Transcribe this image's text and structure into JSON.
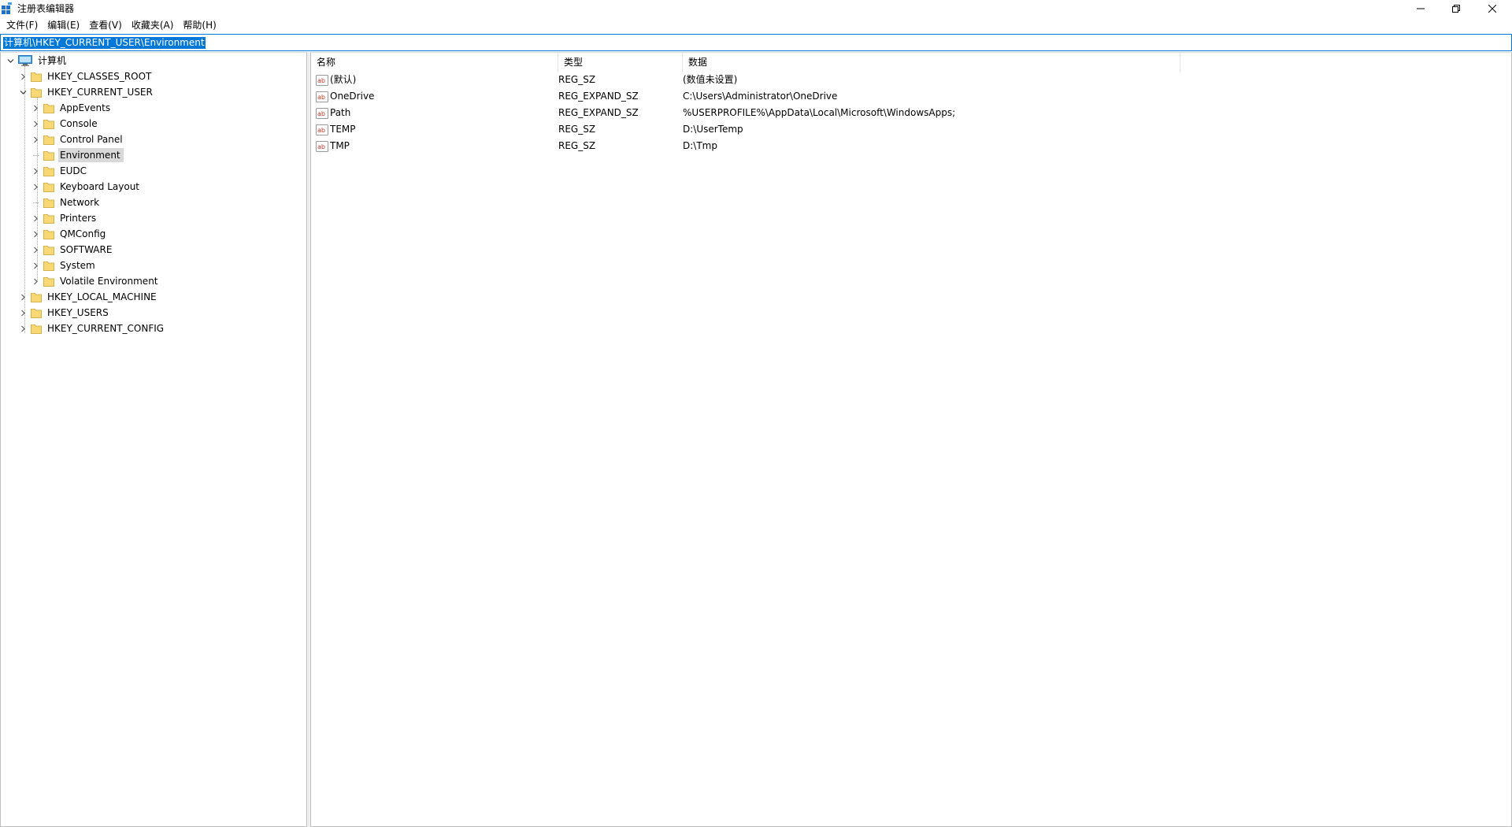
{
  "window": {
    "title": "注册表编辑器",
    "icon": "registry-editor-icon",
    "controls": [
      "minimize-icon",
      "restore-icon",
      "close-icon"
    ]
  },
  "menu": [
    "文件(F)",
    "编辑(E)",
    "查看(V)",
    "收藏夹(A)",
    "帮助(H)"
  ],
  "address": {
    "value": "计算机\\HKEY_CURRENT_USER\\Environment"
  },
  "tree": {
    "root": "计算机",
    "hives": {
      "classes_root": "HKEY_CLASSES_ROOT",
      "current_user": "HKEY_CURRENT_USER",
      "local_machine": "HKEY_LOCAL_MACHINE",
      "users": "HKEY_USERS",
      "current_config": "HKEY_CURRENT_CONFIG"
    },
    "current_user_children": [
      "AppEvents",
      "Console",
      "Control Panel",
      "Environment",
      "EUDC",
      "Keyboard Layout",
      "Network",
      "Printers",
      "QMConfig",
      "SOFTWARE",
      "System",
      "Volatile Environment"
    ],
    "selected": "Environment"
  },
  "list": {
    "columns": [
      "名称",
      "类型",
      "数据"
    ],
    "rows": [
      {
        "name": "(默认)",
        "type": "REG_SZ",
        "data": "(数值未设置)"
      },
      {
        "name": "OneDrive",
        "type": "REG_EXPAND_SZ",
        "data": "C:\\Users\\Administrator\\OneDrive"
      },
      {
        "name": "Path",
        "type": "REG_EXPAND_SZ",
        "data": "%USERPROFILE%\\AppData\\Local\\Microsoft\\WindowsApps;"
      },
      {
        "name": "TEMP",
        "type": "REG_SZ",
        "data": "D:\\UserTemp"
      },
      {
        "name": "TMP",
        "type": "REG_SZ",
        "data": "D:\\Tmp"
      }
    ]
  },
  "colors": {
    "accent": "#0078d7",
    "folder": "#f8d775",
    "selection_gray": "#d9d9d9",
    "string_value_icon": "#c0392b"
  }
}
